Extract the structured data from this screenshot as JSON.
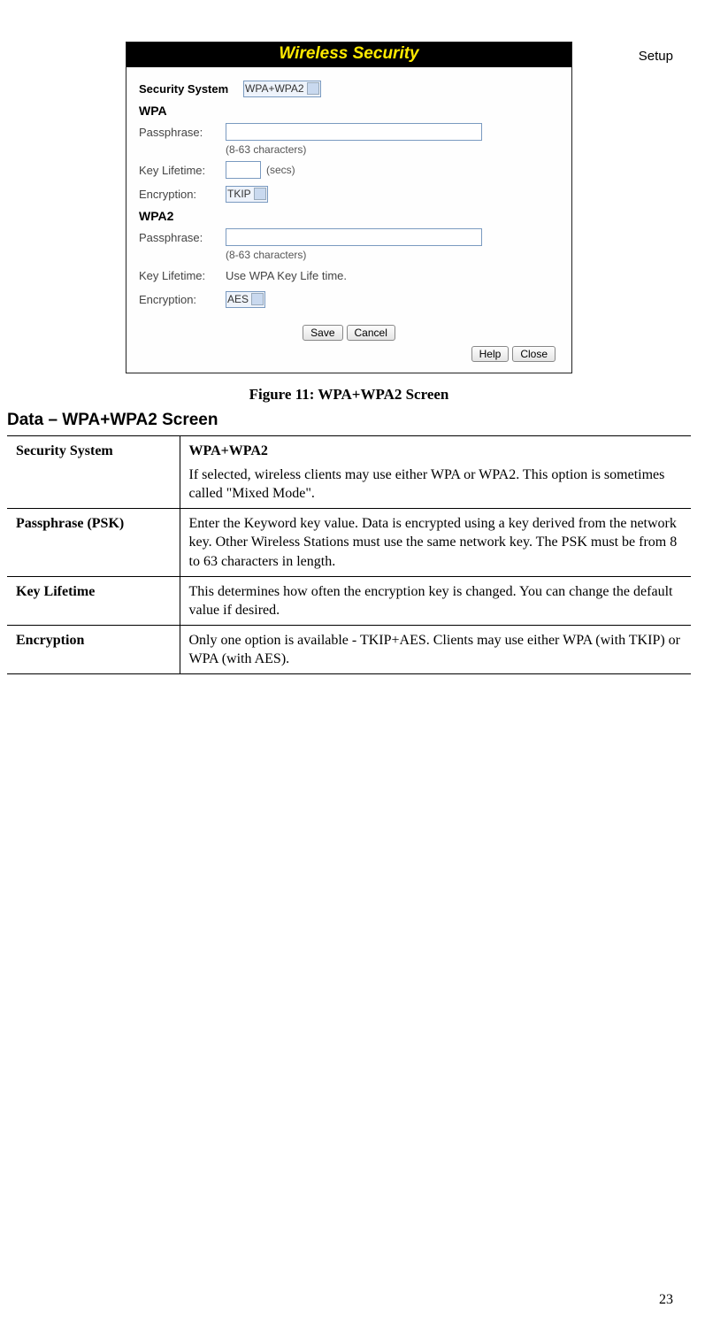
{
  "chapter": "Setup",
  "router": {
    "title": "Wireless Security",
    "security_system_label": "Security System",
    "security_system_value": "WPA+WPA2",
    "wpa_label": "WPA",
    "wpa2_label": "WPA2",
    "passphrase_label": "Passphrase:",
    "passphrase_hint": "(8-63 characters)",
    "keylifetime_label": "Key Lifetime:",
    "keylifetime_unit": "(secs)",
    "encryption_label": "Encryption:",
    "wpa_encryption_value": "TKIP",
    "wpa2_keylifetime_value": "Use WPA Key Life time.",
    "wpa2_encryption_value": "AES",
    "buttons": {
      "save": "Save",
      "cancel": "Cancel",
      "help": "Help",
      "close": "Close"
    }
  },
  "fig_caption": "Figure 11: WPA+WPA2 Screen",
  "section_title": "Data – WPA+WPA2 Screen",
  "table": {
    "rows": [
      {
        "label": "Security System",
        "title": "WPA+WPA2",
        "body": "If selected, wireless clients may use either WPA or WPA2. This option is sometimes called \"Mixed Mode\"."
      },
      {
        "label": "Passphrase (PSK)",
        "body": "Enter the Keyword key value. Data is encrypted using a key derived from the network key. Other Wireless Stations must use the same network key. The PSK must be from 8 to 63 characters in length."
      },
      {
        "label": "Key Lifetime",
        "body": "This determines how often the encryption key is changed. You can change the default value if desired."
      },
      {
        "label": "Encryption",
        "body": "Only one option is available - TKIP+AES. Clients may use either WPA (with TKIP) or WPA (with AES)."
      }
    ]
  },
  "page_no": "23"
}
